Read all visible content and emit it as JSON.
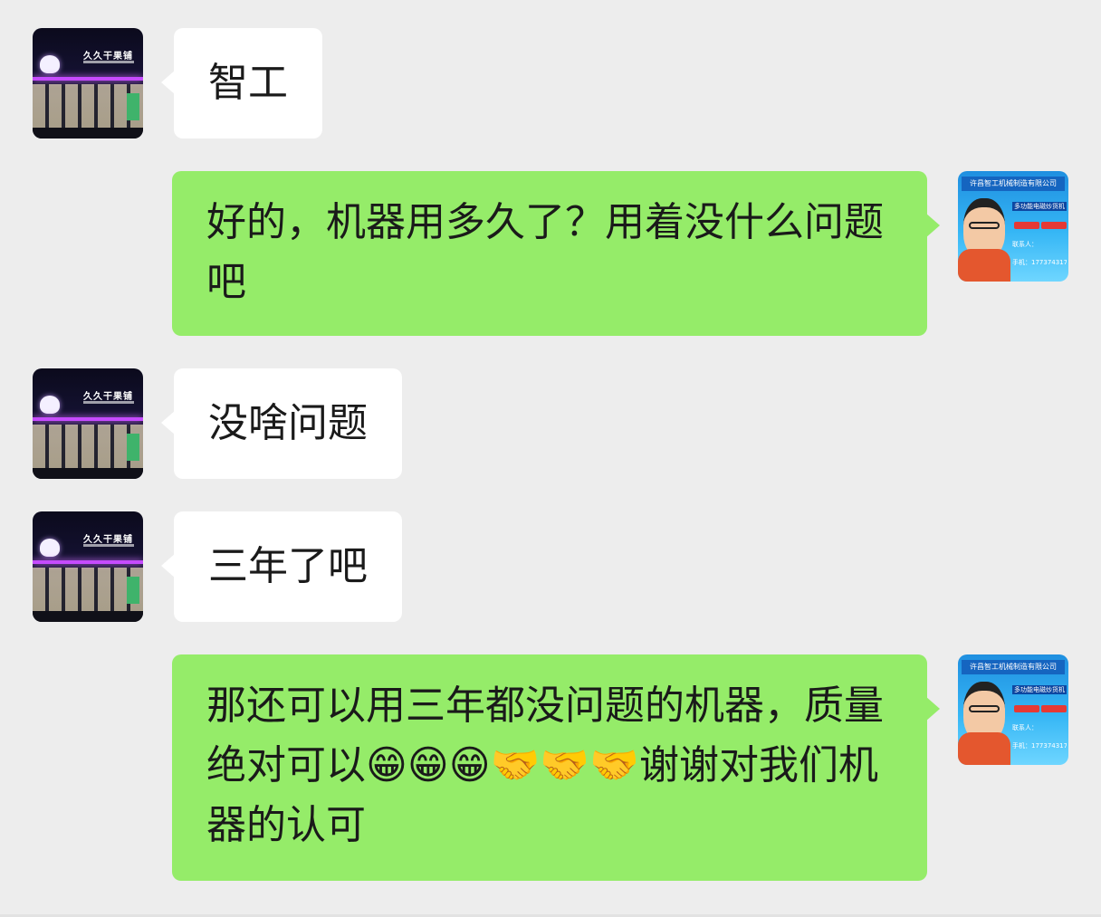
{
  "chat": {
    "messages": [
      {
        "sender": "contact",
        "text": "智工"
      },
      {
        "sender": "self",
        "text": "好的，机器用多久了？用着没什么问题吧"
      },
      {
        "sender": "contact",
        "text": "没啥问题"
      },
      {
        "sender": "contact",
        "text": "三年了吧"
      },
      {
        "sender": "self",
        "text": "那还可以用三年都没问题的机器，质量绝对可以😁😁😁🤝🤝🤝谢谢对我们机器的认可"
      }
    ]
  },
  "avatars": {
    "contact": {
      "sign_text": "久久干果铺"
    },
    "self": {
      "company": "许昌智工机械制造有限公司",
      "product": "多功能电磁炒货机",
      "contact_label": "联系人：",
      "phone": "手机：17737431799"
    }
  },
  "colors": {
    "background": "#ededed",
    "sent_bubble": "#95ec69",
    "received_bubble": "#ffffff",
    "text": "#1a1a1a"
  }
}
